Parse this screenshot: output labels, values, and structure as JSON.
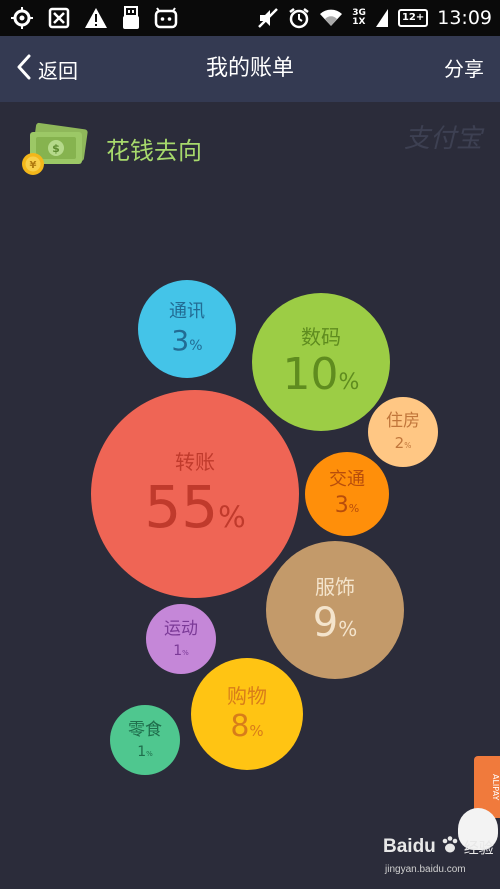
{
  "status_bar": {
    "time": "13:09",
    "network_top": "3G",
    "network_bottom": "1X",
    "battery": "12+",
    "icons": [
      "location-icon",
      "app-icon",
      "warning-icon",
      "usb-icon",
      "robot-icon",
      "mute-icon",
      "alarm-icon",
      "wifi-icon",
      "signal-icon",
      "battery-icon"
    ]
  },
  "nav": {
    "back_label": "返回",
    "title": "我的账单",
    "share_label": "分享"
  },
  "section": {
    "title": "花钱去向",
    "watermark": "支付宝",
    "icon": "money-icon"
  },
  "spending": [
    {
      "category": "转账",
      "percent": "55",
      "percent_value": 55,
      "color": "#ef6555",
      "text_color": "#c03a2c"
    },
    {
      "category": "数码",
      "percent": "10",
      "percent_value": 10,
      "color": "#9ccd45",
      "text_color": "#5f8c1f"
    },
    {
      "category": "服饰",
      "percent": "9",
      "percent_value": 9,
      "color": "#c39a6a",
      "text_color": "#f4e4cc"
    },
    {
      "category": "购物",
      "percent": "8",
      "percent_value": 8,
      "color": "#ffc413",
      "text_color": "#d87d1a"
    },
    {
      "category": "通讯",
      "percent": "3",
      "percent_value": 3,
      "color": "#44c4e8",
      "text_color": "#226c94"
    },
    {
      "category": "交通",
      "percent": "3",
      "percent_value": 3,
      "color": "#ff8f0a",
      "text_color": "#b84d0b"
    },
    {
      "category": "住房",
      "percent": "2",
      "percent_value": 2,
      "color": "#ffc784",
      "text_color": "#c1763b"
    },
    {
      "category": "运动",
      "percent": "1",
      "percent_value": 1,
      "color": "#c587d8",
      "text_color": "#7b3a97"
    },
    {
      "category": "零食",
      "percent": "1",
      "percent_value": 1,
      "color": "#4fc78f",
      "text_color": "#1f6e4c"
    }
  ],
  "percent_symbol": "%",
  "footer": {
    "brand": "Baidu",
    "brand_cn": "经验",
    "url": "jingyan.baidu.com",
    "ribbon_text": "ALIPAY"
  }
}
